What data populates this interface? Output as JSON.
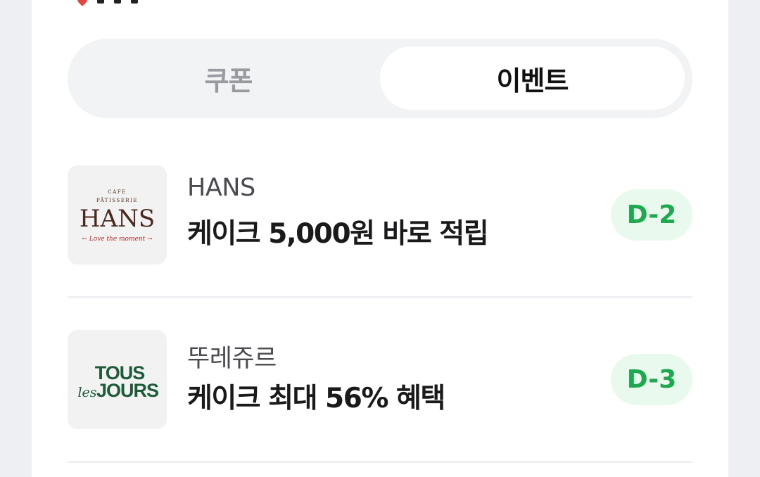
{
  "tabs": {
    "coupon_label": "쿠폰",
    "event_label": "이벤트",
    "active": "event"
  },
  "events": [
    {
      "brand": "HANS",
      "title": "케이크 5,000원 바로 적립",
      "badge": "D-2",
      "logo": {
        "top": "CAFE",
        "arc": "PÂTISSERIE",
        "name": "HANS",
        "tagline": "← Love the moment →"
      }
    },
    {
      "brand": "뚜레쥬르",
      "title": "케이크 최대 56% 혜택",
      "badge": "D-3",
      "logo": {
        "line1": "TOUS",
        "line2a": "les",
        "line2b": "JOURS"
      }
    }
  ],
  "colors": {
    "badge_bg": "#e9f9ee",
    "badge_text": "#1fa84f",
    "hans_brown": "#4a2a1e",
    "hans_red": "#b3302c",
    "tous_green": "#1f5a3a"
  }
}
